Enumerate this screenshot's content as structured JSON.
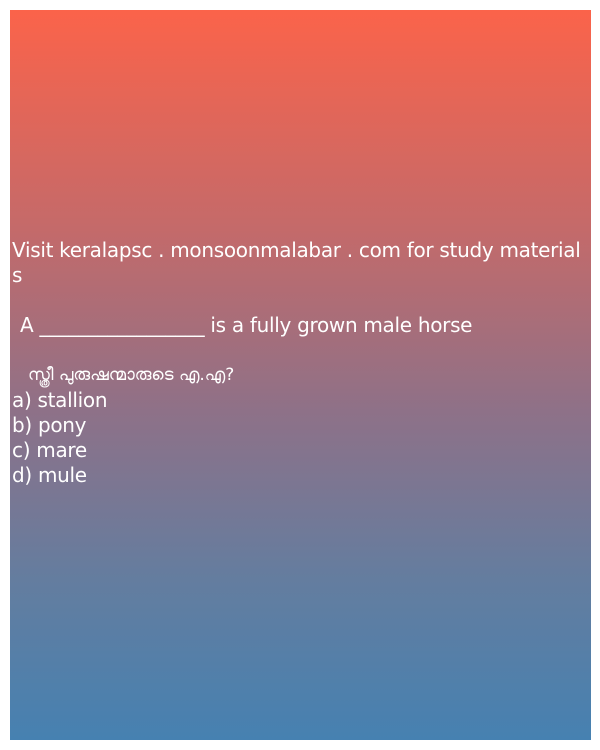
{
  "visit_text": "Visit keralapsc . monsoonmalabar . com for study materials",
  "question": {
    "text": "A _________________ is a fully grown male horse",
    "malayalam": "സ്ത്രീ പുരുഷന്മാരുടെ എ.എ?"
  },
  "options": [
    "a) stallion",
    "b) pony",
    "c) mare",
    "d) mule"
  ],
  "colors": {
    "gradient_top": "#fb634a",
    "gradient_bottom": "#4681b1",
    "text": "#ffffff"
  }
}
